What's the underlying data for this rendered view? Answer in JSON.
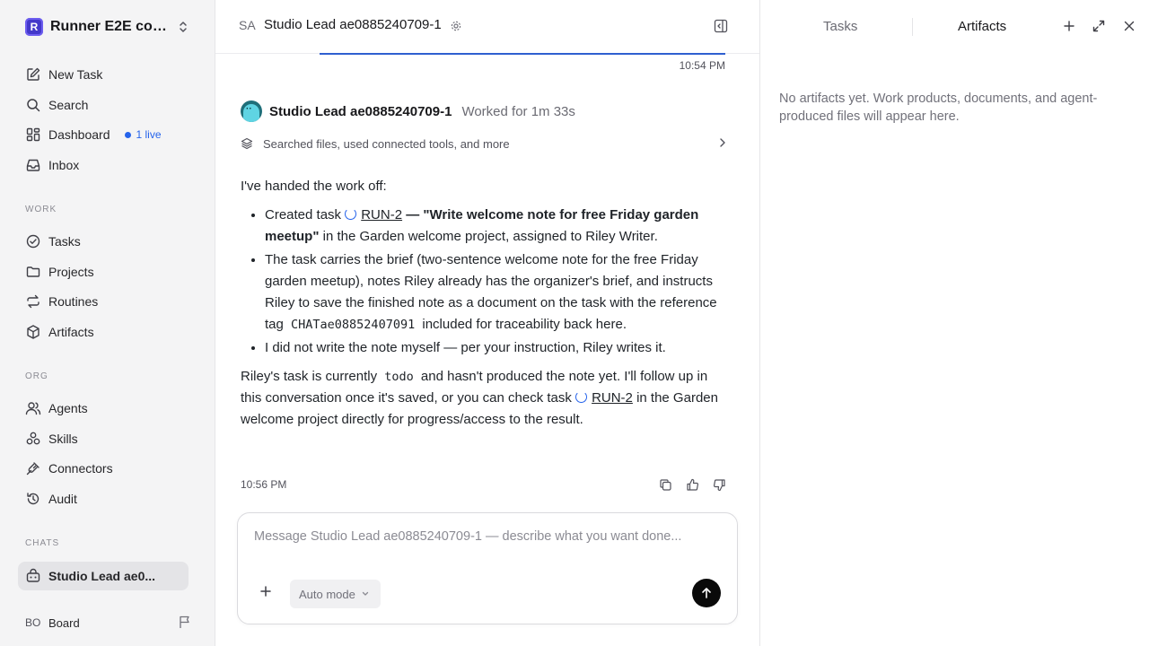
{
  "workspace": {
    "logo_letter": "R",
    "name": "Runner E2E com..."
  },
  "nav": {
    "new_task": "New Task",
    "search": "Search",
    "dashboard": "Dashboard",
    "dashboard_live": "1 live",
    "inbox": "Inbox"
  },
  "sections": {
    "work": "WORK",
    "org": "ORG",
    "chats": "CHATS"
  },
  "work_items": {
    "tasks": "Tasks",
    "projects": "Projects",
    "routines": "Routines",
    "artifacts": "Artifacts"
  },
  "org_items": {
    "agents": "Agents",
    "skills": "Skills",
    "connectors": "Connectors",
    "audit": "Audit"
  },
  "chats": {
    "active": "Studio Lead ae0..."
  },
  "board": {
    "initials": "BO",
    "label": "Board"
  },
  "chat_header": {
    "avatar": "SA",
    "title": "Studio Lead ae0885240709-1"
  },
  "thread": {
    "prev_time": "10:54 PM",
    "agent_name": "Studio Lead ae0885240709-1",
    "worked": "Worked for 1m 33s",
    "tools_summary": "Searched files, used connected tools, and more",
    "intro": "I've handed the work off:",
    "b1_prefix": "Created task ",
    "b1_link": "RUN-2",
    "b1_bold": " — \"Write welcome note for free Friday garden meetup\"",
    "b1_suffix": " in the Garden welcome project, assigned to Riley Writer.",
    "b2_part1": "The task carries the brief (two-sentence welcome note for the free Friday garden meetup), notes Riley already has the organizer's brief, and instructs Riley to save the finished note as a document on the task with the reference tag ",
    "b2_code": "CHATae08852407091",
    "b2_part2": " included for traceability back here.",
    "b3": "I did not write the note myself — per your instruction, Riley writes it.",
    "p2_part1": "Riley's task is currently ",
    "p2_code": "todo",
    "p2_part2": " and hasn't produced the note yet. I'll follow up in this conversation once it's saved, or you can check task ",
    "p2_link": "RUN-2",
    "p2_part3": " in the Garden welcome project directly for progress/access to the result.",
    "time": "10:56 PM"
  },
  "composer": {
    "placeholder": "Message Studio Lead ae0885240709-1 — describe what you want done...",
    "value": "",
    "mode": "Auto mode"
  },
  "right_panel": {
    "tab_tasks": "Tasks",
    "tab_artifacts": "Artifacts",
    "active_tab": "Artifacts",
    "empty": "No artifacts yet. Work products, documents, and agent-produced files will appear here."
  },
  "colors": {
    "accent": "#2563eb",
    "logo": "#4338ca",
    "send": "#0a0a0a"
  }
}
